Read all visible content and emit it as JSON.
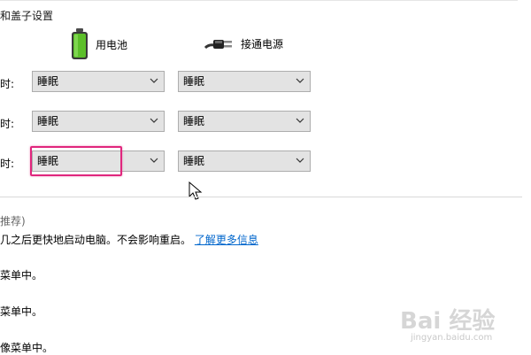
{
  "section": {
    "title": "和盖子设置"
  },
  "columns": {
    "battery": {
      "label": "用电池",
      "icon": "battery-icon"
    },
    "plugged": {
      "label": "接通电源",
      "icon": "power-plug-icon"
    }
  },
  "rows": [
    {
      "label": "时:",
      "battery_value": "睡眠",
      "plugged_value": "睡眠"
    },
    {
      "label": "时:",
      "battery_value": "睡眠",
      "plugged_value": "睡眠"
    },
    {
      "label": "时:",
      "battery_value": "睡眠",
      "plugged_value": "睡眠"
    }
  ],
  "fast_startup": {
    "title": "推荐)",
    "description": "几之后更快地启动电脑。不会影响重启。",
    "link": "了解更多信息"
  },
  "options": [
    {
      "text": "菜单中。"
    },
    {
      "text": "菜单中。"
    },
    {
      "text": "像菜单中。"
    }
  ],
  "watermark": {
    "logo": "Bai 经验",
    "url": "jingyan.baidu.com"
  },
  "colors": {
    "highlight": "#e0267d",
    "link": "#0066cc",
    "battery": "#5cbf2a"
  }
}
